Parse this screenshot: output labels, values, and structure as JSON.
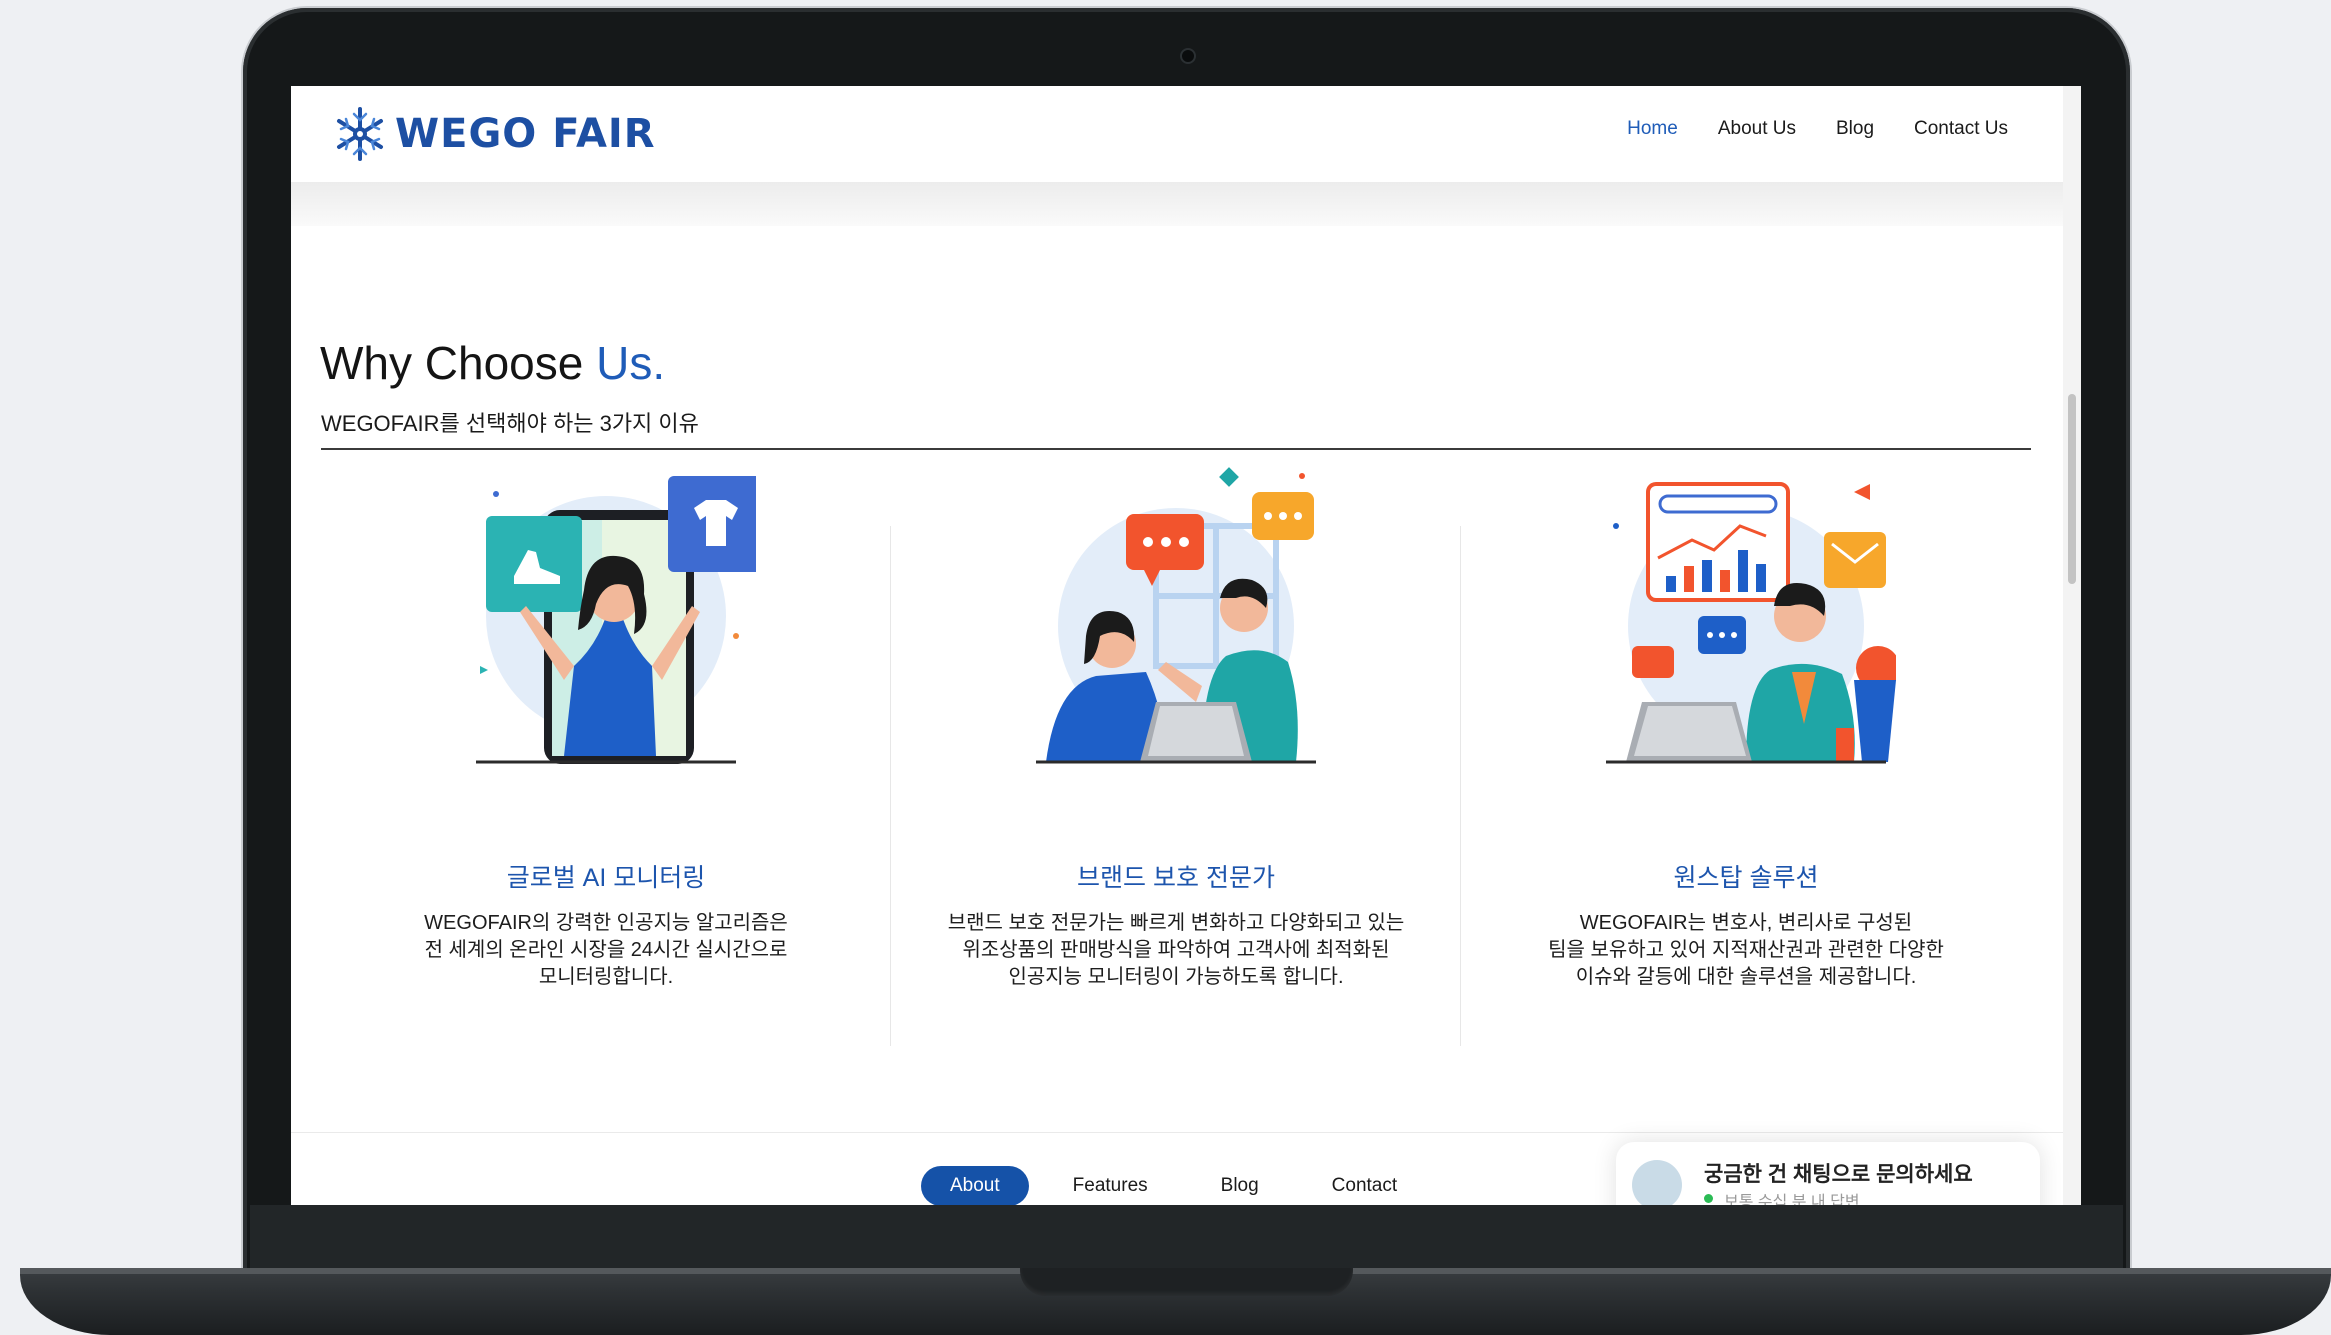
{
  "header": {
    "logo_text": "WEGO FAIR",
    "nav": [
      {
        "label": "Home",
        "active": true
      },
      {
        "label": "About Us"
      },
      {
        "label": "Blog"
      },
      {
        "label": "Contact Us"
      }
    ]
  },
  "section": {
    "title_main": "Why Choose ",
    "title_accent": "Us.",
    "subtitle": "WEGOFAIR를 선택해야 하는 3가지 이유"
  },
  "features": [
    {
      "title": "글로벌 AI 모니터링",
      "lines": [
        "WEGOFAIR의 강력한 인공지능 알고리즘은",
        "전 세계의 온라인 시장을 24시간 실시간으로",
        "모니터링합니다."
      ]
    },
    {
      "title": "브랜드 보호 전문가",
      "lines": [
        "브랜드 보호 전문가는 빠르게 변화하고 다양화되고 있는",
        "위조상품의 판매방식을 파악하여 고객사에 최적화된",
        "인공지능 모니터링이 가능하도록 합니다."
      ]
    },
    {
      "title": "원스탑 솔루션",
      "lines": [
        "WEGOFAIR는 변호사, 변리사로 구성된",
        "팀을 보유하고 있어 지적재산권과 관련한 다양한",
        "이슈와 갈등에 대한 솔루션을 제공합니다."
      ]
    }
  ],
  "bottom_nav": [
    {
      "label": "About",
      "active": true
    },
    {
      "label": "Features"
    },
    {
      "label": "Blog"
    },
    {
      "label": "Contact"
    }
  ],
  "chat": {
    "title": "궁금한 건 채팅으로 문의하세요",
    "subtitle": "보통 수십 분 내 답변"
  },
  "colors": {
    "brand": "#1d4fa3",
    "accent": "#1f5cb8",
    "pill": "#1552a8"
  }
}
